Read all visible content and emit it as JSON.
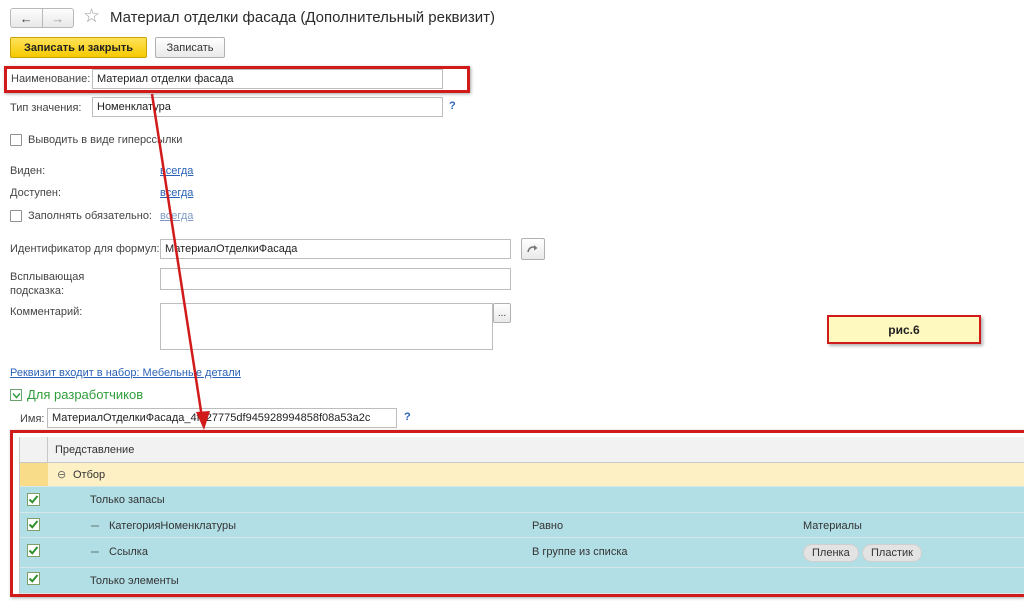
{
  "header": {
    "back_icon": "←",
    "forward_icon": "→",
    "star_icon": "☆",
    "title": "Материал отделки фасада (Дополнительный реквизит)"
  },
  "toolbar": {
    "save_close_label": "Записать и закрыть",
    "save_label": "Записать"
  },
  "form": {
    "name_label": "Наименование:",
    "name_value": "Материал отделки фасада",
    "type_label": "Тип значения:",
    "type_value": "Номенклатура",
    "type_help": "?",
    "hyperlink_label": "Выводить в виде гиперссылки",
    "visible_label": "Виден:",
    "visible_value": "всегда",
    "available_label": "Доступен:",
    "available_value": "всегда",
    "required_label": "Заполнять обязательно:",
    "required_value": "всегда",
    "formula_id_label": "Идентификатор для формул:",
    "formula_id_value": "МатериалОтделкиФасада",
    "tooltip_label_line1": "Всплывающая",
    "tooltip_label_line2": "подсказка:",
    "tooltip_value": "",
    "comment_label": "Комментарий:",
    "comment_value": "",
    "comment_more": "...",
    "set_link": "Реквизит входит в набор: Мебельные детали",
    "dev_section_label": "Для разработчиков",
    "dev_name_label": "Имя:",
    "dev_name_value": "МатериалОтделкиФасада_4fb27775df945928994858f08a53a2c",
    "dev_name_help": "?"
  },
  "figure_label": "рис.6",
  "grid": {
    "header": "Представление",
    "rows": [
      {
        "text": "Отбор",
        "expander": "⊖"
      },
      {
        "text": "Только запасы",
        "checked": true
      },
      {
        "text": "КатегорияНоменклатуры",
        "condition": "Равно",
        "value": "Материалы",
        "checked": true
      },
      {
        "text": "Ссылка",
        "condition": "В группе из списка",
        "checked": true,
        "pills": [
          "Пленка",
          "Пластик"
        ]
      },
      {
        "text": "Только элементы",
        "checked": true
      }
    ]
  },
  "colors": {
    "accent_red": "#d11a1a",
    "primary_button": "#f5c900",
    "grid_row": "#b2dfe6",
    "grid_group_row": "#fdf0c4",
    "link": "#2a62b6",
    "section_green": "#2f9e3a"
  }
}
